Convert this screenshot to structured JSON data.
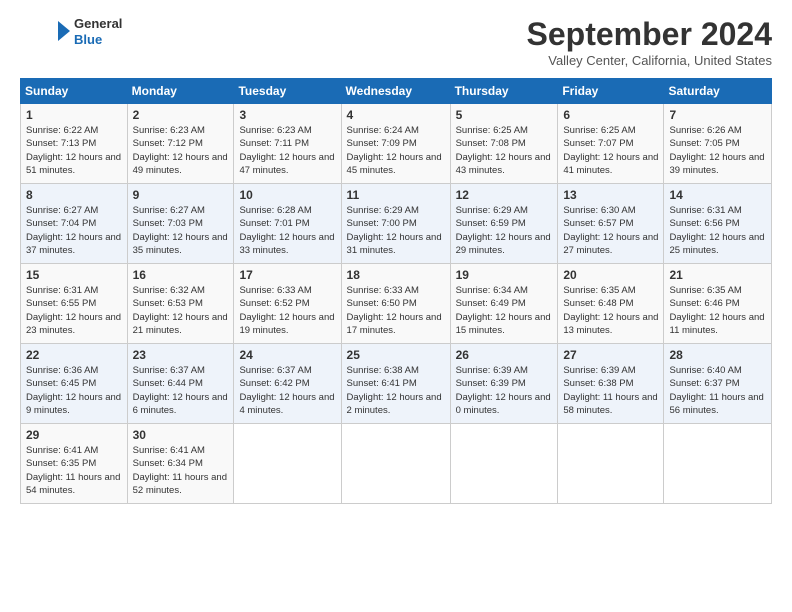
{
  "logo": {
    "general": "General",
    "blue": "Blue"
  },
  "header": {
    "title": "September 2024",
    "location": "Valley Center, California, United States"
  },
  "weekdays": [
    "Sunday",
    "Monday",
    "Tuesday",
    "Wednesday",
    "Thursday",
    "Friday",
    "Saturday"
  ],
  "weeks": [
    [
      {
        "day": "1",
        "sunrise": "6:22 AM",
        "sunset": "7:13 PM",
        "daylight": "12 hours and 51 minutes."
      },
      {
        "day": "2",
        "sunrise": "6:23 AM",
        "sunset": "7:12 PM",
        "daylight": "12 hours and 49 minutes."
      },
      {
        "day": "3",
        "sunrise": "6:23 AM",
        "sunset": "7:11 PM",
        "daylight": "12 hours and 47 minutes."
      },
      {
        "day": "4",
        "sunrise": "6:24 AM",
        "sunset": "7:09 PM",
        "daylight": "12 hours and 45 minutes."
      },
      {
        "day": "5",
        "sunrise": "6:25 AM",
        "sunset": "7:08 PM",
        "daylight": "12 hours and 43 minutes."
      },
      {
        "day": "6",
        "sunrise": "6:25 AM",
        "sunset": "7:07 PM",
        "daylight": "12 hours and 41 minutes."
      },
      {
        "day": "7",
        "sunrise": "6:26 AM",
        "sunset": "7:05 PM",
        "daylight": "12 hours and 39 minutes."
      }
    ],
    [
      {
        "day": "8",
        "sunrise": "6:27 AM",
        "sunset": "7:04 PM",
        "daylight": "12 hours and 37 minutes."
      },
      {
        "day": "9",
        "sunrise": "6:27 AM",
        "sunset": "7:03 PM",
        "daylight": "12 hours and 35 minutes."
      },
      {
        "day": "10",
        "sunrise": "6:28 AM",
        "sunset": "7:01 PM",
        "daylight": "12 hours and 33 minutes."
      },
      {
        "day": "11",
        "sunrise": "6:29 AM",
        "sunset": "7:00 PM",
        "daylight": "12 hours and 31 minutes."
      },
      {
        "day": "12",
        "sunrise": "6:29 AM",
        "sunset": "6:59 PM",
        "daylight": "12 hours and 29 minutes."
      },
      {
        "day": "13",
        "sunrise": "6:30 AM",
        "sunset": "6:57 PM",
        "daylight": "12 hours and 27 minutes."
      },
      {
        "day": "14",
        "sunrise": "6:31 AM",
        "sunset": "6:56 PM",
        "daylight": "12 hours and 25 minutes."
      }
    ],
    [
      {
        "day": "15",
        "sunrise": "6:31 AM",
        "sunset": "6:55 PM",
        "daylight": "12 hours and 23 minutes."
      },
      {
        "day": "16",
        "sunrise": "6:32 AM",
        "sunset": "6:53 PM",
        "daylight": "12 hours and 21 minutes."
      },
      {
        "day": "17",
        "sunrise": "6:33 AM",
        "sunset": "6:52 PM",
        "daylight": "12 hours and 19 minutes."
      },
      {
        "day": "18",
        "sunrise": "6:33 AM",
        "sunset": "6:50 PM",
        "daylight": "12 hours and 17 minutes."
      },
      {
        "day": "19",
        "sunrise": "6:34 AM",
        "sunset": "6:49 PM",
        "daylight": "12 hours and 15 minutes."
      },
      {
        "day": "20",
        "sunrise": "6:35 AM",
        "sunset": "6:48 PM",
        "daylight": "12 hours and 13 minutes."
      },
      {
        "day": "21",
        "sunrise": "6:35 AM",
        "sunset": "6:46 PM",
        "daylight": "12 hours and 11 minutes."
      }
    ],
    [
      {
        "day": "22",
        "sunrise": "6:36 AM",
        "sunset": "6:45 PM",
        "daylight": "12 hours and 9 minutes."
      },
      {
        "day": "23",
        "sunrise": "6:37 AM",
        "sunset": "6:44 PM",
        "daylight": "12 hours and 6 minutes."
      },
      {
        "day": "24",
        "sunrise": "6:37 AM",
        "sunset": "6:42 PM",
        "daylight": "12 hours and 4 minutes."
      },
      {
        "day": "25",
        "sunrise": "6:38 AM",
        "sunset": "6:41 PM",
        "daylight": "12 hours and 2 minutes."
      },
      {
        "day": "26",
        "sunrise": "6:39 AM",
        "sunset": "6:39 PM",
        "daylight": "12 hours and 0 minutes."
      },
      {
        "day": "27",
        "sunrise": "6:39 AM",
        "sunset": "6:38 PM",
        "daylight": "11 hours and 58 minutes."
      },
      {
        "day": "28",
        "sunrise": "6:40 AM",
        "sunset": "6:37 PM",
        "daylight": "11 hours and 56 minutes."
      }
    ],
    [
      {
        "day": "29",
        "sunrise": "6:41 AM",
        "sunset": "6:35 PM",
        "daylight": "11 hours and 54 minutes."
      },
      {
        "day": "30",
        "sunrise": "6:41 AM",
        "sunset": "6:34 PM",
        "daylight": "11 hours and 52 minutes."
      },
      null,
      null,
      null,
      null,
      null
    ]
  ]
}
